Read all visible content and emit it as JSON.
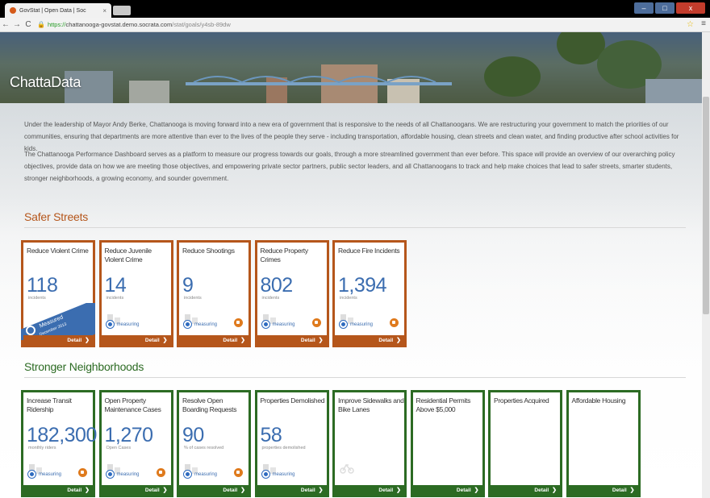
{
  "browser": {
    "tab_title": "GovStat | Open Data | Soc",
    "tab_close": "×",
    "url_scheme": "https://",
    "url_host": "chattanooga-govstat.demo.socrata.com",
    "url_path": "/stat/goals/y4sb-89dw",
    "back_glyph": "←",
    "forward_glyph": "→",
    "reload_glyph": "C",
    "lock_glyph": "🔒",
    "star_glyph": "☆",
    "menu_glyph": "≡",
    "min_glyph": "–",
    "max_glyph": "□",
    "close_glyph": "x"
  },
  "site": {
    "title": "ChattaData"
  },
  "intro": {
    "paragraph1": "Under the leadership of Mayor Andy Berke, Chattanooga is moving forward into a new era of government that is responsive to the needs of all Chattanoogans. We are restructuring your government to match the priorities of our communities, ensuring that departments are more attentive than ever to the lives of the people they serve - including transportation, affordable housing, clean streets and clean water, and finding productive after school activities for kids.",
    "paragraph2": "The Chattanooga Performance Dashboard serves as a platform to measure our progress towards our goals, through a more streamlined government than ever before. This space will provide an overview of our overarching policy objectives, provide data on how we are meeting those objectives, and empowering private sector partners, public sector leaders, and all Chattanoogans to track and help make choices that lead to safer streets, smarter students, stronger neighborhoods, a growing economy, and sounder government."
  },
  "colors": {
    "safer_streets": "#b5561b",
    "stronger_neighborhoods": "#2c6b23",
    "value_blue": "#3b6db0"
  },
  "sections": [
    {
      "title": "Safer Streets",
      "cards": [
        {
          "name": "Reduce Violent Crime",
          "value": "118",
          "unit": "incidents",
          "status": "Measured",
          "status_date": "December 2013",
          "featured": true,
          "detail": "Detail"
        },
        {
          "name": "Reduce Juvenile Violent Crime",
          "value": "14",
          "unit": "incidents",
          "status": "measuring",
          "detail": "Detail"
        },
        {
          "name": "Reduce Shootings",
          "value": "9",
          "unit": "incidents",
          "status": "measuring",
          "detail": "Detail"
        },
        {
          "name": "Reduce Property Crimes",
          "value": "802",
          "unit": "incidents",
          "status": "measuring",
          "detail": "Detail"
        },
        {
          "name": "Reduce Fire Incidents",
          "value": "1,394",
          "unit": "incidents",
          "status": "measuring",
          "detail": "Detail"
        }
      ]
    },
    {
      "title": "Stronger Neighborhoods",
      "cards": [
        {
          "name": "Increase Transit Ridership",
          "value": "182,300",
          "unit": "monthly riders",
          "status": "measuring",
          "detail": "Detail"
        },
        {
          "name": "Open Property Maintenance Cases",
          "value": "1,270",
          "unit": "Open Cases",
          "status": "measuring",
          "detail": "Detail"
        },
        {
          "name": "Resolve Open Boarding Requests",
          "value": "90",
          "unit": "% of cases resolved",
          "status": "measuring",
          "detail": "Detail"
        },
        {
          "name": "Properties Demolished",
          "value": "58",
          "unit": "properties demolished",
          "status": "measuring",
          "detail": "Detail"
        },
        {
          "name": "Improve Sidewalks and Bike Lanes",
          "value": "",
          "unit": "",
          "status": "",
          "detail": "Detail"
        },
        {
          "name": "Residential Permits Above $5,000",
          "value": "",
          "unit": "",
          "status": "",
          "detail": "Detail"
        },
        {
          "name": "Properties Acquired",
          "value": "",
          "unit": "",
          "status": "",
          "detail": "Detail"
        },
        {
          "name": "Affordable Housing",
          "value": "",
          "unit": "",
          "status": "",
          "detail": "Detail"
        }
      ]
    }
  ],
  "detail_chevron": "❯"
}
